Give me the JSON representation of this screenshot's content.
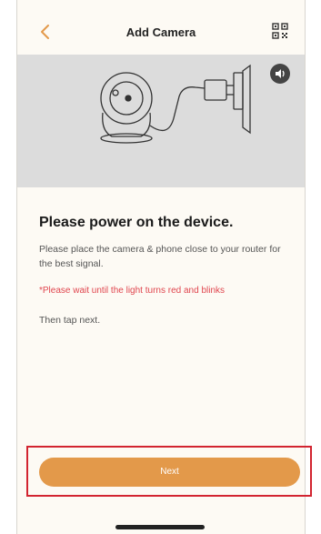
{
  "header": {
    "title": "Add Camera",
    "back_icon": "chevron-left-icon",
    "qr_icon": "qr-code-icon",
    "accent_color": "#e3994a"
  },
  "hero": {
    "illustration": "camera-plugged-into-wall-outlet",
    "sound_icon": "speaker-icon"
  },
  "content": {
    "heading": "Please power on the device.",
    "description": "Please place the camera & phone close to your router for the best signal.",
    "warning": "*Please wait until the light turns red and blinks",
    "instruction": "Then tap next."
  },
  "footer": {
    "next_label": "Next",
    "highlight_color": "#d22430"
  }
}
